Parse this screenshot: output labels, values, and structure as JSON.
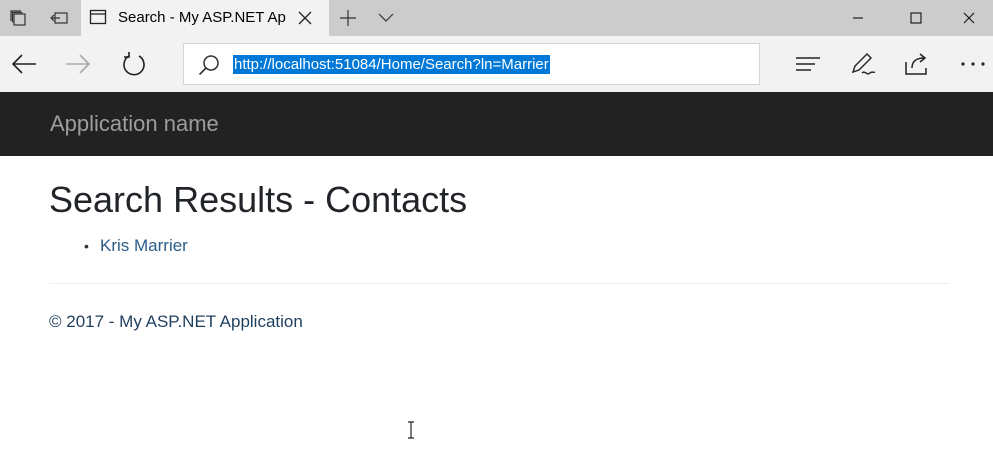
{
  "browser": {
    "tab": {
      "title": "Search - My ASP.NET Ap",
      "icon": "page-icon"
    },
    "tab_strip_icons": [
      "tab-set-aside-icon",
      "restore-tabs-icon",
      "new-tab-icon",
      "tab-preview-chevron-icon"
    ],
    "window_controls": [
      "minimize-icon",
      "maximize-icon",
      "close-icon"
    ],
    "address": {
      "url": "http://localhost:51084/Home/Search?ln=Marrier",
      "selection_color": "#0078d7"
    },
    "toolbar_icons": [
      "back-icon",
      "forward-icon",
      "refresh-icon",
      "hub-icon",
      "web-note-icon",
      "share-icon",
      "more-icon"
    ]
  },
  "site": {
    "brand": "Application name",
    "navbar_color": "#222222"
  },
  "main": {
    "title": "Search Results - Contacts",
    "results": [
      {
        "name": "Kris Marrier"
      }
    ]
  },
  "footer": {
    "text": "© 2017 - My ASP.NET Application"
  }
}
